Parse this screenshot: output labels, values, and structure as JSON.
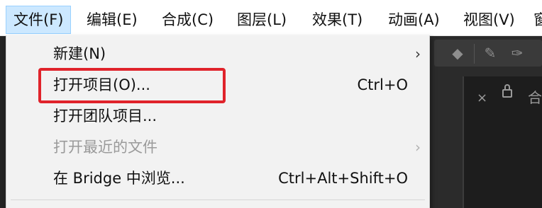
{
  "menubar": {
    "items": [
      {
        "label": "文件(F)"
      },
      {
        "label": "编辑(E)"
      },
      {
        "label": "合成(C)"
      },
      {
        "label": "图层(L)"
      },
      {
        "label": "效果(T)"
      },
      {
        "label": "动画(A)"
      },
      {
        "label": "视图(V)"
      },
      {
        "label": "窗"
      }
    ]
  },
  "file_menu": {
    "items": [
      {
        "label": "新建(N)",
        "shortcut": "",
        "submenu_arrow": "›",
        "enabled": true
      },
      {
        "label": "打开项目(O)...",
        "shortcut": "Ctrl+O",
        "submenu_arrow": "",
        "enabled": true
      },
      {
        "label": "打开团队项目...",
        "shortcut": "",
        "submenu_arrow": "",
        "enabled": true
      },
      {
        "label": "打开最近的文件",
        "shortcut": "",
        "submenu_arrow": "›",
        "enabled": false
      },
      {
        "label": "在 Bridge 中浏览...",
        "shortcut": "Ctrl+Alt+Shift+O",
        "submenu_arrow": "",
        "enabled": true
      }
    ]
  },
  "panel": {
    "close_glyph": "×",
    "tab_glyph": "合"
  },
  "toolbar_icons": [
    "eraser-icon",
    "puppet-pin-icon",
    "roto-brush-icon"
  ],
  "colors": {
    "highlight_border": "#e0232b",
    "menubar_active_bg": "#cce8ff",
    "dropdown_bg": "#f2f2f2"
  }
}
